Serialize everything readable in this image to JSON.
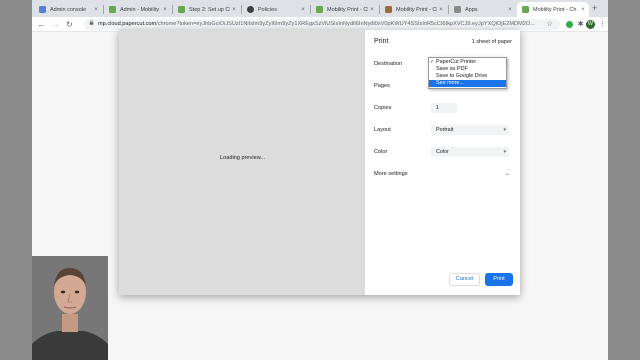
{
  "tabs": [
    {
      "label": "Admin console",
      "favicon_color": "#5b7fcf",
      "active": false
    },
    {
      "label": "Admin - Mobility P",
      "favicon_color": "#6aa84f",
      "active": false
    },
    {
      "label": "Step 2: Set up Chr",
      "favicon_color": "#6aa84f",
      "active": false
    },
    {
      "label": "Policies",
      "favicon_color": "#3c4043",
      "active": false
    },
    {
      "label": "Mobility Print - Chr",
      "favicon_color": "#6aa84f",
      "active": false
    },
    {
      "label": "Mobility Print - Chr",
      "favicon_color": "#9c6b3c",
      "active": false
    },
    {
      "label": "Apps",
      "favicon_color": "#8a8a8a",
      "active": false
    },
    {
      "label": "Mobility Print - Ch",
      "favicon_color": "#6aa84f",
      "active": true
    }
  ],
  "toolbar": {
    "url_host": "mp.cloud.papercut.com",
    "url_rest": "/chrome?token=eyJhbGciOiJSUzI1NiIsIm9yZyI6Im9yZy1XREgxSzViUSIsInNydiI6InNydi0xV0pKWUY4SSIsInR5cCI6IkpXVCJ9.eyJpYXQiOjE2MDM2O...",
    "profile_initial": "W"
  },
  "print": {
    "title": "Print",
    "sheets": "1 sheet of paper",
    "loading": "Loading preview...",
    "destination_label": "Destination",
    "pages_label": "Pages",
    "copies_label": "Copies",
    "copies_value": "1",
    "layout_label": "Layout",
    "layout_value": "Portrait",
    "color_label": "Color",
    "color_value": "Color",
    "more_settings": "More settings",
    "cancel": "Cancel",
    "print": "Print"
  },
  "destination_options": [
    {
      "label": "PaperCut Printer",
      "checked": true,
      "highlighted": false
    },
    {
      "label": "Save as PDF",
      "checked": false,
      "highlighted": false
    },
    {
      "label": "Save to Google Drive",
      "checked": false,
      "highlighted": false
    },
    {
      "label": "See more...",
      "checked": false,
      "highlighted": true
    }
  ],
  "icons": {
    "back": "arrow-left-icon",
    "forward": "arrow-right-icon",
    "reload": "reload-icon",
    "lock": "lock-icon",
    "star": "star-icon",
    "extensions": "puzzle-icon",
    "menu": "kebab-menu-icon"
  },
  "colors": {
    "accent": "#1a73e8",
    "tabstrip": "#dee1e6",
    "preview": "#dcdcdc"
  }
}
